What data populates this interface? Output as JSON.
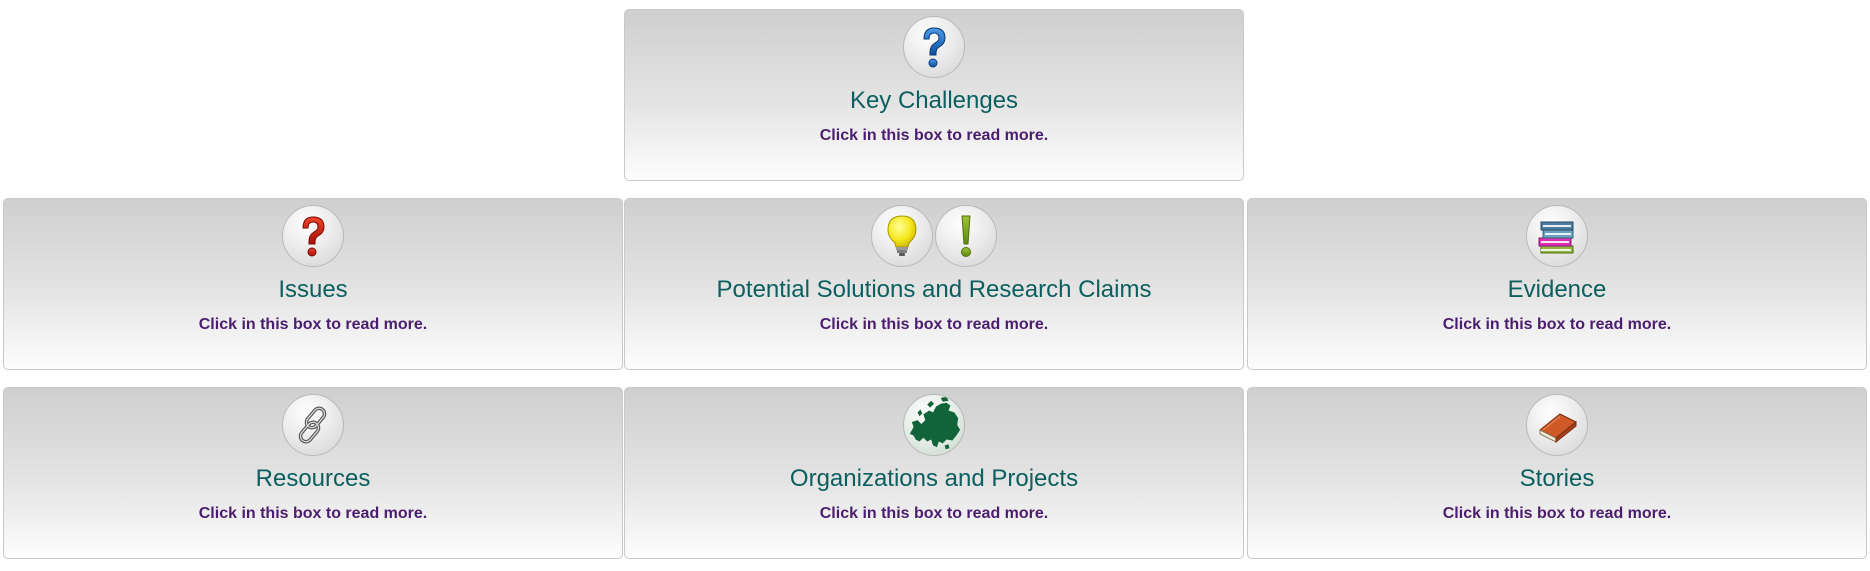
{
  "boxes": {
    "key_challenges": {
      "title": "Key Challenges",
      "more": "Click in this box to read more.",
      "icons": [
        "blue-question-mark-icon"
      ]
    },
    "issues": {
      "title": "Issues",
      "more": "Click in this box to read more.",
      "icons": [
        "red-question-mark-icon"
      ]
    },
    "solutions": {
      "title": "Potential Solutions and Research Claims",
      "more": "Click in this box to read more.",
      "icons": [
        "lightbulb-icon",
        "exclamation-mark-icon"
      ]
    },
    "evidence": {
      "title": "Evidence",
      "more": "Click in this box to read more.",
      "icons": [
        "books-stack-icon"
      ]
    },
    "resources": {
      "title": "Resources",
      "more": "Click in this box to read more.",
      "icons": [
        "chain-link-icon"
      ]
    },
    "organizations": {
      "title": "Organizations and Projects",
      "more": "Click in this box to read more.",
      "icons": [
        "europe-map-icon"
      ]
    },
    "stories": {
      "title": "Stories",
      "more": "Click in this box to read more.",
      "icons": [
        "book-icon"
      ]
    }
  },
  "colors": {
    "title": "#0c5f5f",
    "more": "#4b1d6e",
    "border": "#c9c9c9"
  }
}
